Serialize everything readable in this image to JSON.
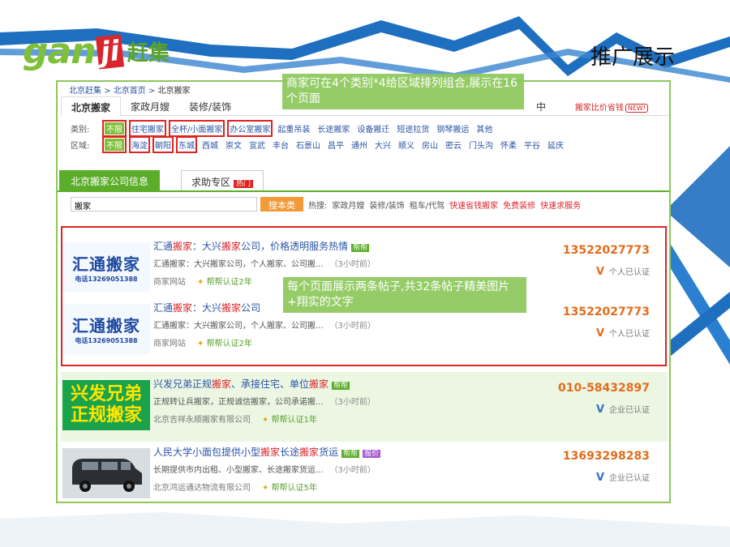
{
  "slide": {
    "title": "推广展示",
    "logo_latin": "gan",
    "logo_ji": "ji",
    "logo_cn": "赶集"
  },
  "breadcrumb": {
    "items": [
      "北京赶集",
      "北京首页",
      "北京搬家"
    ],
    "separator": ">"
  },
  "tabs": [
    {
      "label": "北京搬家",
      "active": true
    },
    {
      "label": "家政月嫂",
      "active": false
    },
    {
      "label": "装修/装饰",
      "active": false
    }
  ],
  "tab_hidden_tail": "中",
  "tab_right": {
    "label": "搬家比价省钱",
    "badge": "NEW!"
  },
  "filters": {
    "category": {
      "label": "类别:",
      "options": [
        "不限",
        "住宅搬家",
        "全杯/小面搬家",
        "办公室搬家",
        "起重吊装",
        "长途搬家",
        "设备搬迁",
        "短途拉货",
        "钢琴搬运",
        "其他"
      ]
    },
    "district": {
      "label": "区域:",
      "options": [
        "不限",
        "海淀",
        "朝阳",
        "东城",
        "西城",
        "崇文",
        "宣武",
        "丰台",
        "石景山",
        "昌平",
        "通州",
        "大兴",
        "顺义",
        "房山",
        "密云",
        "门头沟",
        "怀柔",
        "平谷",
        "延庆"
      ]
    }
  },
  "section_tabs": {
    "active": "北京搬家公司信息",
    "other": "求助专区",
    "hot_badge": "热门"
  },
  "search": {
    "value": "搬家",
    "button": "搜本类",
    "hot_label": "热搜:",
    "hot_items": [
      "家政月嫂",
      "装修/装饰",
      "租车/代驾"
    ],
    "promo_items": [
      "快速省钱搬家",
      "免费装修",
      "快速求服务"
    ]
  },
  "listings": [
    {
      "thumb_line1": "汇通搬家",
      "thumb_line2": "电话13269051388",
      "title_a": "汇通",
      "title_b": "搬家",
      "title_c": "：大兴",
      "title_d": "搬家",
      "title_e": "公司，价格透明服务热情",
      "badge": "帮帮",
      "desc": "汇通搬家：大兴搬家公司，个人搬家、公司搬...",
      "time": "（3小时前）",
      "source": "商家网站",
      "cert": "帮帮认证2年",
      "phone": "13522027773",
      "verify": "个人已认证"
    },
    {
      "thumb_line1": "汇通搬家",
      "thumb_line2": "电话13269051388",
      "title_a": "汇通",
      "title_b": "搬家",
      "title_c": "：大兴",
      "title_d": "搬家",
      "title_e": "公司",
      "badge": "",
      "desc": "汇通搬家：大兴搬家公司，个人搬家、公司搬...",
      "time": "（3小时前）",
      "source": "商家网站",
      "cert": "帮帮认证2年",
      "phone": "13522027773",
      "verify": "个人已认证"
    },
    {
      "thumb_line1": "兴发兄弟",
      "thumb_line2": "正规搬家",
      "title_a": "兴发兄弟正规",
      "title_b": "搬家",
      "title_c": "、承接住宅、单位",
      "title_d": "搬家",
      "title_e": "",
      "badge": "帮帮",
      "desc": "正规转让兵搬家，正规诚信搬家，公司承诺搬...",
      "time": "（3小时前）",
      "source": "北京吉祥永顺搬家有限公司",
      "cert": "帮帮认证1年",
      "phone": "010-58432897",
      "verify": "企业已认证"
    },
    {
      "thumb_line1": "",
      "thumb_line2": "",
      "title_a": "人民大学小面包提供小型",
      "title_b": "搬家",
      "title_c": "长途",
      "title_d": "搬家",
      "title_e": "货运",
      "badge": "帮帮",
      "badge2": "报价",
      "desc": "长期提供市内出租、小型搬家、长途搬家货运...",
      "time": "（3小时前）",
      "source": "北京鸿运通达物流有限公司",
      "cert": "帮帮认证5年",
      "phone": "13693298283",
      "verify": "企业已认证"
    }
  ],
  "notes": {
    "top": "商家可在4个类别*4给区域排列组合,展示在16个页面",
    "middle": "每个页面展示两条帖子,共32条帖子精美图片+翔实的文字"
  },
  "colors": {
    "accent_green": "#7fbf3a",
    "frame_green": "#8cc85a",
    "highlight_red": "#e1231f",
    "link_blue": "#2a54a3",
    "phone_orange": "#e36c1b",
    "ribbon_blue": "#1f6fc0"
  }
}
